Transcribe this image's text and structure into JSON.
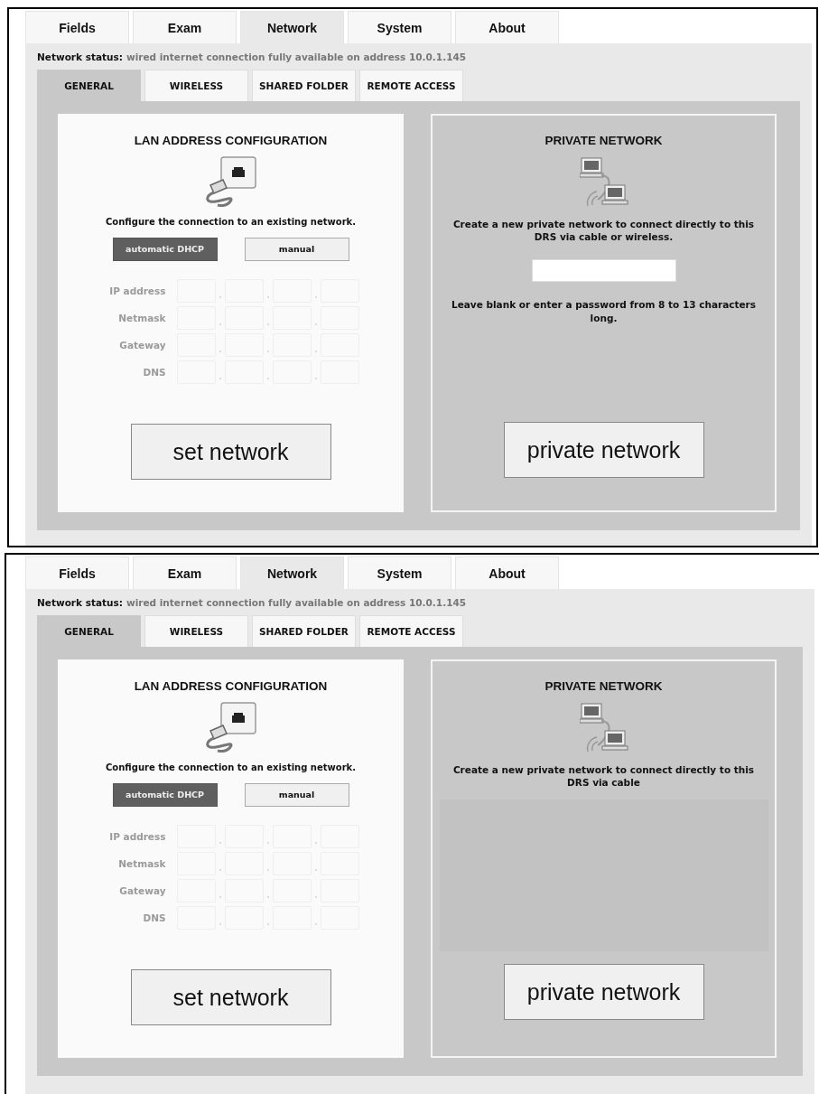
{
  "screens": [
    {
      "tabs": [
        {
          "label": "Fields",
          "selected": false
        },
        {
          "label": "Exam",
          "selected": false
        },
        {
          "label": "Network",
          "selected": true
        },
        {
          "label": "System",
          "selected": false
        },
        {
          "label": "About",
          "selected": false
        }
      ],
      "status": {
        "label": "Network status:",
        "text": "wired internet connection fully available on address 10.0.1.145"
      },
      "subtabs": [
        {
          "label": "GENERAL",
          "selected": true
        },
        {
          "label": "WIRELESS",
          "selected": false
        },
        {
          "label": "SHARED FOLDER",
          "selected": false
        },
        {
          "label": "REMOTE ACCESS",
          "selected": false
        }
      ],
      "lan": {
        "title": "LAN ADDRESS CONFIGURATION",
        "description": "Configure the connection to an existing network.",
        "modes": [
          {
            "label": "automatic DHCP",
            "selected": true
          },
          {
            "label": "manual",
            "selected": false
          }
        ],
        "address_rows": [
          {
            "label": "IP address",
            "disabled": true
          },
          {
            "label": "Netmask",
            "disabled": true
          },
          {
            "label": "Gateway",
            "disabled": true
          },
          {
            "label": "DNS",
            "disabled": true
          }
        ],
        "button": "set network"
      },
      "private": {
        "title": "PRIVATE NETWORK",
        "description": "Create a new private network to connect directly to this DRS via cable or wireless.",
        "password_field": true,
        "hint": "Leave blank or enter a password from 8 to 13 characters long.",
        "button": "private network"
      }
    },
    {
      "tabs": [
        {
          "label": "Fields",
          "selected": false
        },
        {
          "label": "Exam",
          "selected": false
        },
        {
          "label": "Network",
          "selected": true
        },
        {
          "label": "System",
          "selected": false
        },
        {
          "label": "About",
          "selected": false
        }
      ],
      "status": {
        "label": "Network status:",
        "text": "wired internet connection fully available on address 10.0.1.145"
      },
      "subtabs": [
        {
          "label": "GENERAL",
          "selected": true
        },
        {
          "label": "WIRELESS",
          "selected": false
        },
        {
          "label": "SHARED FOLDER",
          "selected": false
        },
        {
          "label": "REMOTE ACCESS",
          "selected": false
        }
      ],
      "lan": {
        "title": "LAN ADDRESS CONFIGURATION",
        "description": "Configure the connection to an existing network.",
        "modes": [
          {
            "label": "automatic DHCP",
            "selected": true
          },
          {
            "label": "manual",
            "selected": false
          }
        ],
        "address_rows": [
          {
            "label": "IP address",
            "disabled": true
          },
          {
            "label": "Netmask",
            "disabled": true
          },
          {
            "label": "Gateway",
            "disabled": true
          },
          {
            "label": "DNS",
            "disabled": true
          }
        ],
        "button": "set network"
      },
      "private": {
        "title": "PRIVATE NETWORK",
        "description": "Create a new private network to connect directly to this\nDRS via cable",
        "password_field": false,
        "button": "private network"
      }
    }
  ]
}
